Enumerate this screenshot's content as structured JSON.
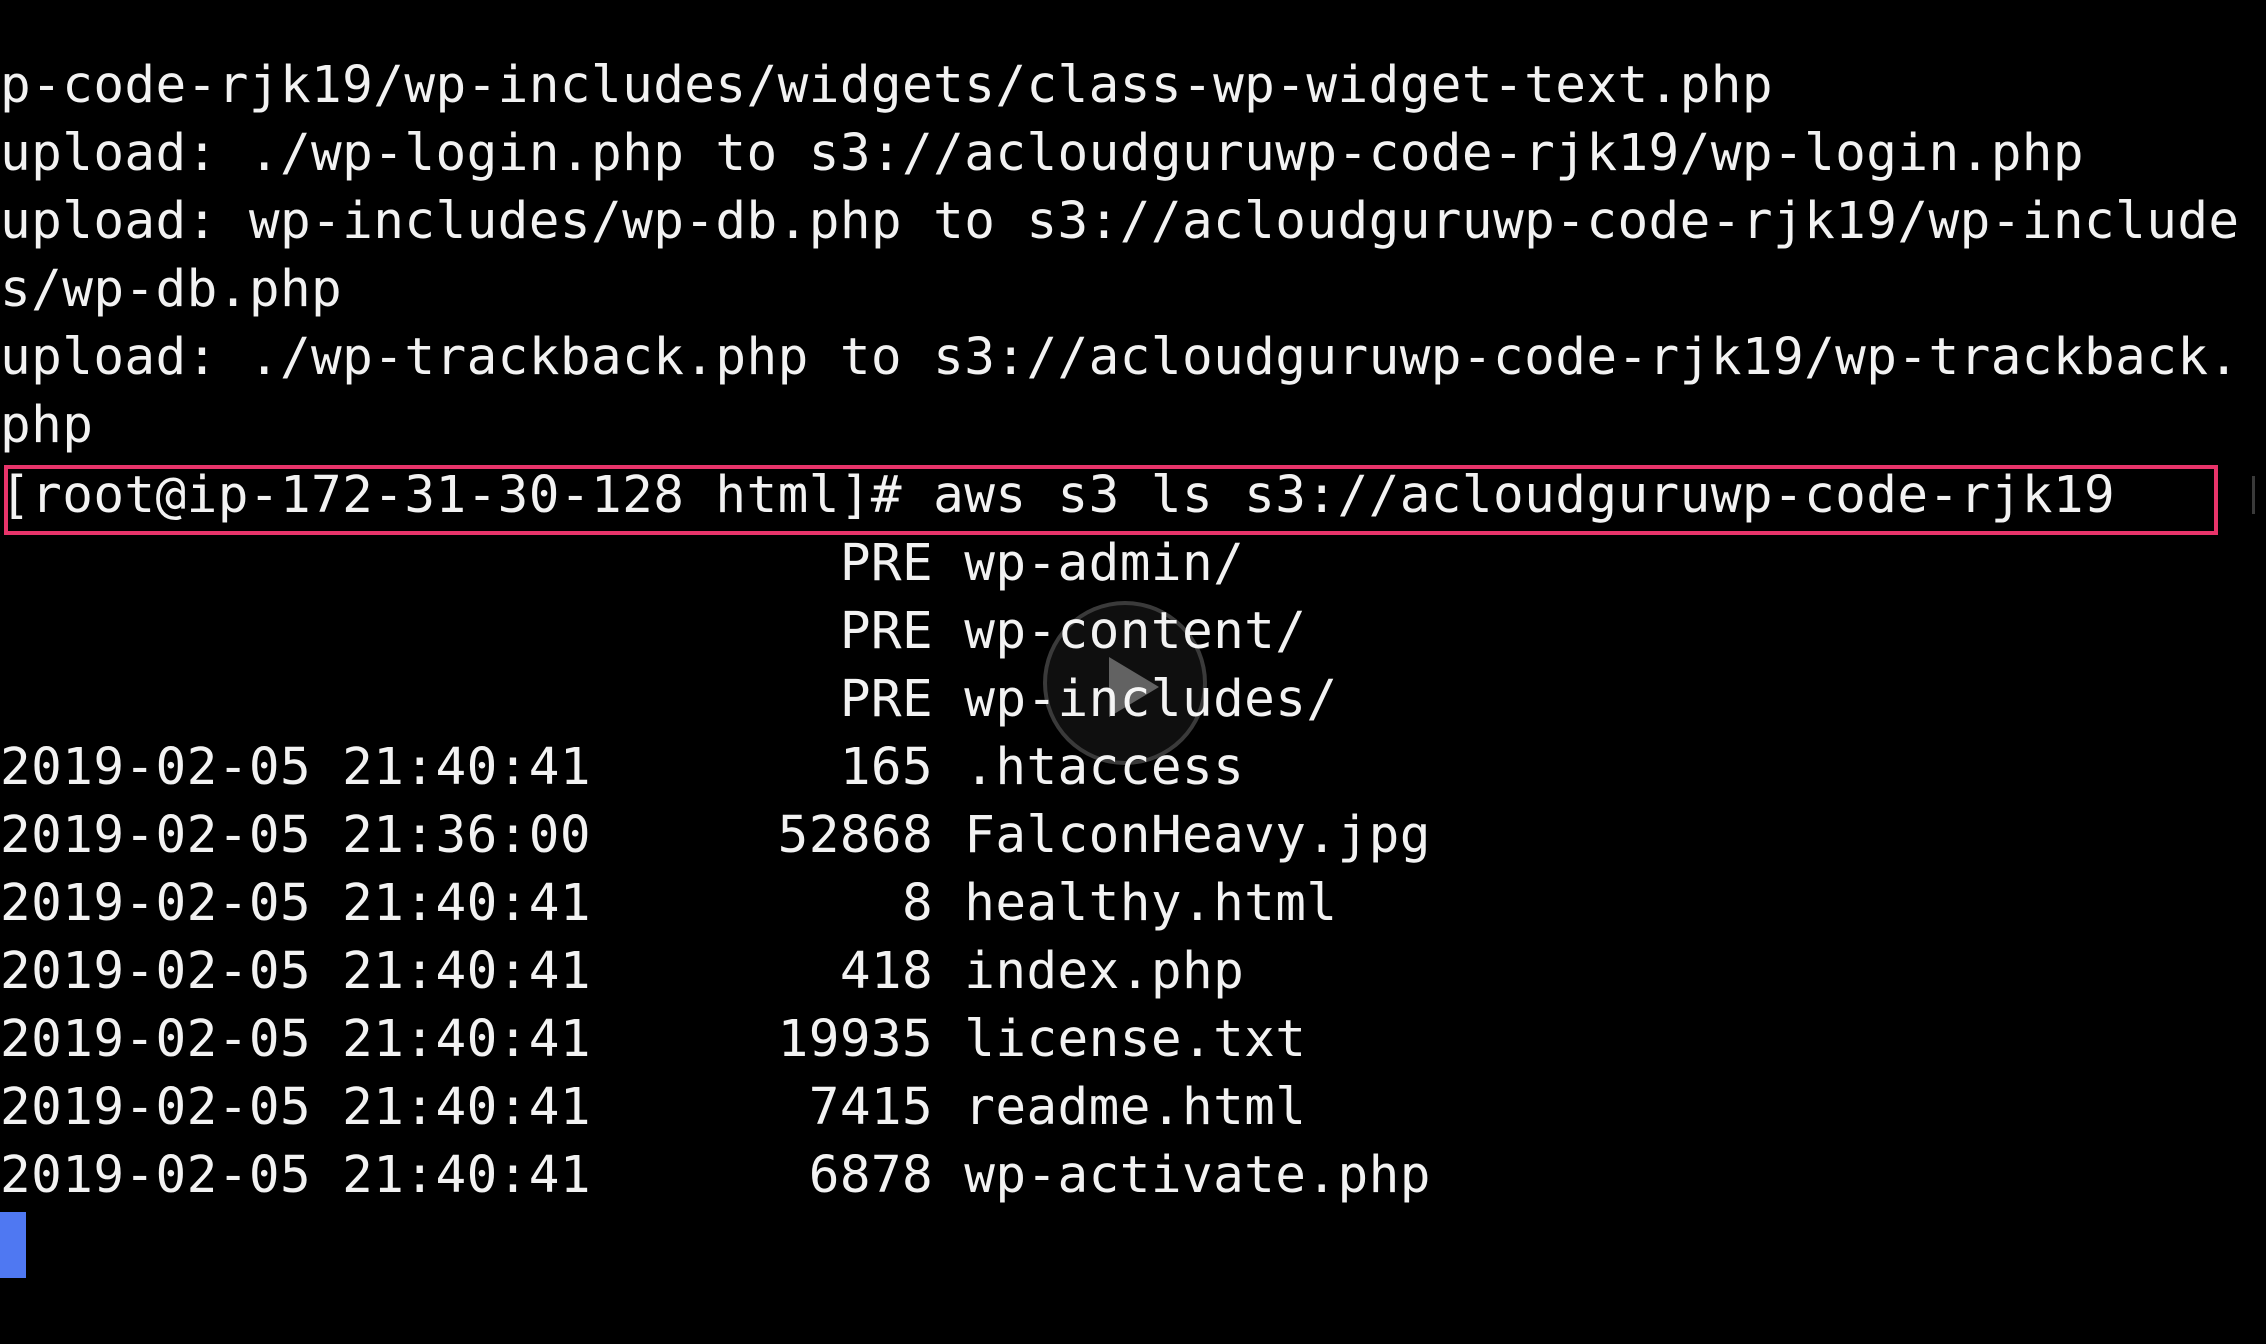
{
  "terminal": {
    "lines": [
      "p-code-rjk19/wp-includes/widgets/class-wp-widget-text.php",
      "upload: ./wp-login.php to s3://acloudguruwp-code-rjk19/wp-login.php",
      "upload: wp-includes/wp-db.php to s3://acloudguruwp-code-rjk19/wp-include",
      "s/wp-db.php",
      "upload: ./wp-trackback.php to s3://acloudguruwp-code-rjk19/wp-trackback.",
      "php",
      "[root@ip-172-31-30-128 html]# aws s3 ls s3://acloudguruwp-code-rjk19",
      "                           PRE wp-admin/",
      "                           PRE wp-content/",
      "                           PRE wp-includes/",
      "2019-02-05 21:40:41        165 .htaccess",
      "2019-02-05 21:36:00      52868 FalconHeavy.jpg",
      "2019-02-05 21:40:41          8 healthy.html",
      "2019-02-05 21:40:41        418 index.php",
      "2019-02-05 21:40:41      19935 license.txt",
      "2019-02-05 21:40:41       7415 readme.html",
      "2019-02-05 21:40:41       6878 wp-activate.php"
    ]
  },
  "colors": {
    "background": "#000000",
    "text": "#f2f2f2",
    "highlight_border": "#e8346a",
    "cursor": "#4f78f2"
  },
  "icons": {
    "play_overlay": "play-icon"
  }
}
